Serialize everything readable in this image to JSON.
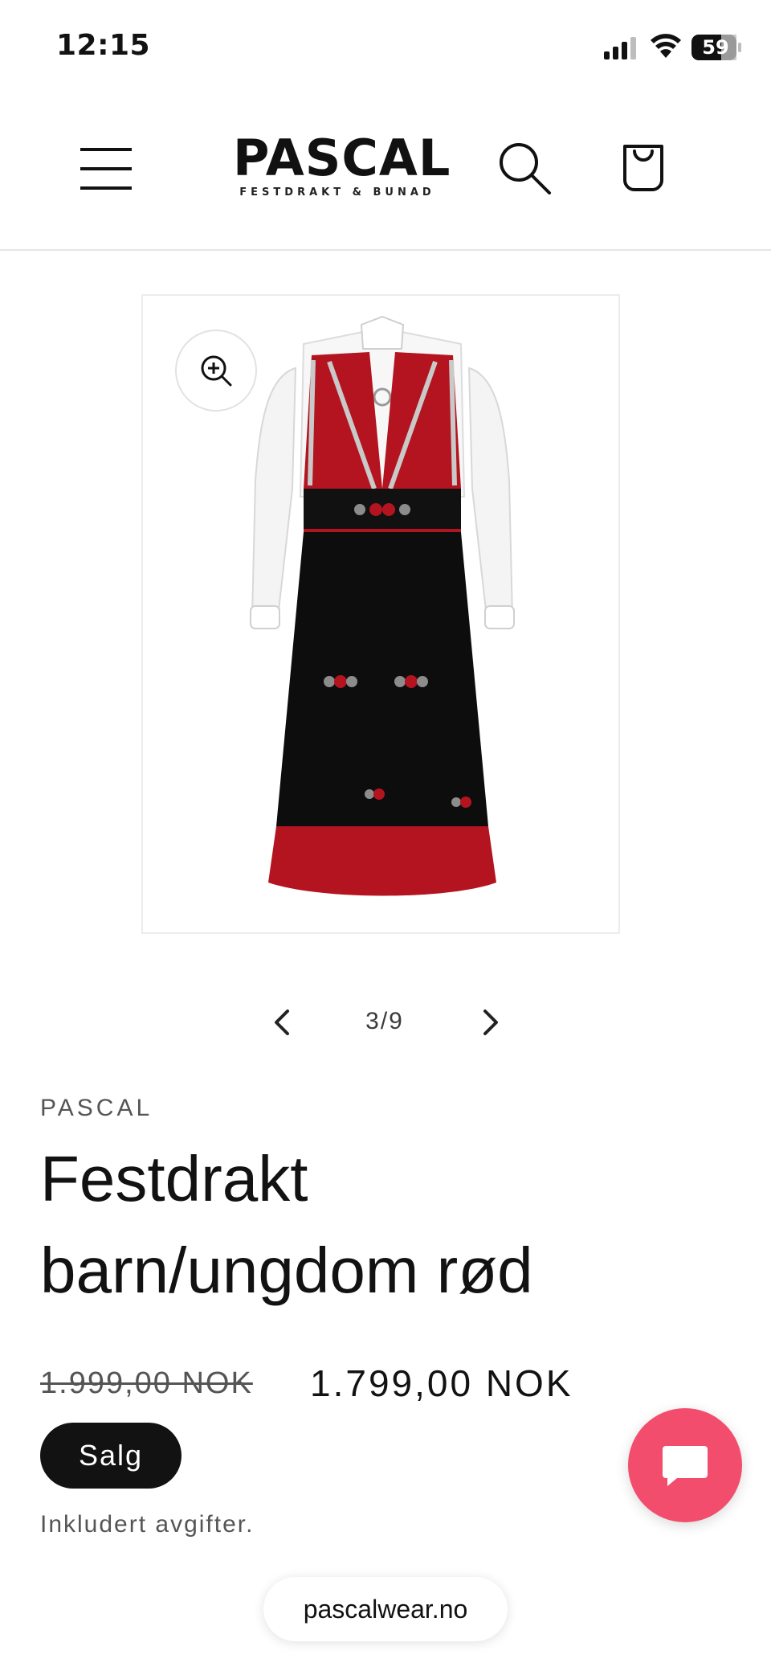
{
  "status_bar": {
    "time": "12:15",
    "battery": "59",
    "icons": [
      "signal-icon",
      "wifi-icon",
      "battery-icon"
    ]
  },
  "header": {
    "logo_text": "PASCAL",
    "logo_tagline": "FESTDRAKT & BUNAD",
    "icons": [
      "menu-icon",
      "search-icon",
      "cart-icon"
    ]
  },
  "gallery": {
    "counter": "3/9",
    "icons": [
      "zoom-in-icon",
      "chevron-left-icon",
      "chevron-right-icon"
    ]
  },
  "product": {
    "vendor": "PASCAL",
    "title": "Festdrakt barn/ungdom rød",
    "price_regular": "1.999,00 NOK",
    "price_sale": "1.799,00 NOK",
    "badge": "Salg",
    "tax_note": "Inkludert avgifter."
  },
  "chat": {
    "icon": "chat-bubble-icon",
    "color": "#f24d6c"
  },
  "browser": {
    "url": "pascalwear.no"
  },
  "colors": {
    "dress_red": "#b3141f",
    "dress_black": "#0d0d0d",
    "text": "#121212"
  }
}
